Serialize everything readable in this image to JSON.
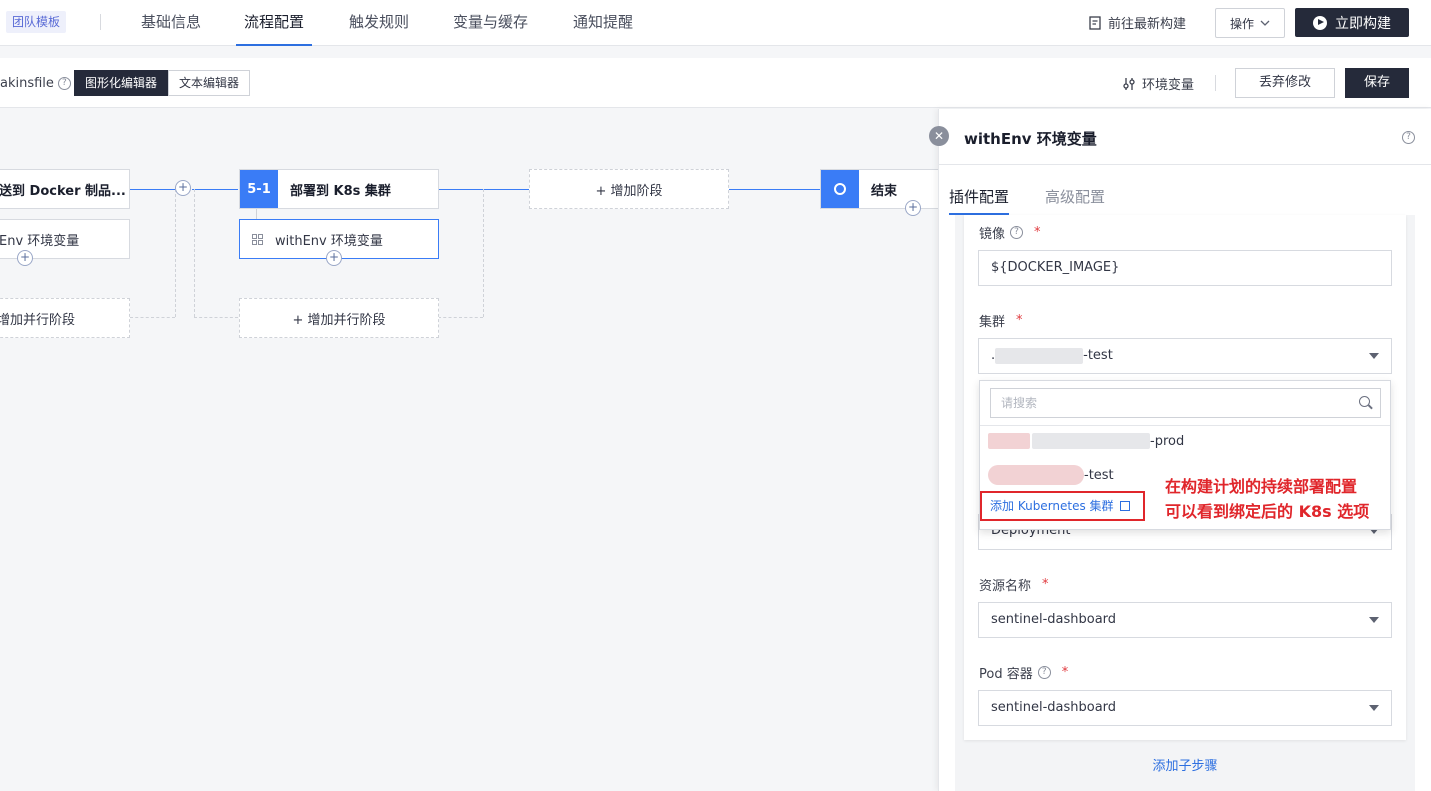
{
  "nav": {
    "team_tag": "团队模板",
    "tabs": [
      "基础信息",
      "流程配置",
      "触发规则",
      "变量与缓存",
      "通知提醒"
    ],
    "active_tab": "流程配置",
    "latest_build": "前往最新构建",
    "operations": "操作",
    "build_now": "立即构建"
  },
  "subbar": {
    "jenkinsfile_label": "akinsfile",
    "editor_graphic": "图形化编辑器",
    "editor_text": "文本编辑器",
    "env_vars": "环境变量",
    "discard": "丢弃修改",
    "save": "保存"
  },
  "canvas": {
    "stage_prev": "送到 Docker 制品...",
    "stage_prev_step": "Env 环境变量",
    "stage_prev_parallel": "增加并行阶段",
    "stage_index": "5-1",
    "stage_name": "部署到 K8s 集群",
    "stage_step": "withEnv 环境变量",
    "add_parallel": "+ 增加并行阶段",
    "add_stage": "+ 增加阶段",
    "end": "结束"
  },
  "panel": {
    "title": "withEnv 环境变量",
    "tabs": [
      "插件配置",
      "高级配置"
    ],
    "active_tab": "插件配置",
    "image_label": "镜像",
    "image_value": "${DOCKER_IMAGE}",
    "cluster_label": "集群",
    "cluster_value_suffix": "-test",
    "cluster_prefix_char": ".",
    "resource_type_value": "Deployment",
    "resource_name_label": "资源名称",
    "resource_name_value": "sentinel-dashboard",
    "pod_container_label": "Pod 容器",
    "pod_container_value": "sentinel-dashboard",
    "add_sub_step": "添加子步骤",
    "required_mark": "*"
  },
  "dropdown": {
    "search_placeholder": "请搜索",
    "options": [
      "-prod",
      "-test"
    ],
    "add_cluster": "添加 Kubernetes 集群"
  },
  "annotation": {
    "line1": "在构建计划的持续部署配置",
    "line2": "可以看到绑定后的 K8s 选项"
  },
  "colors": {
    "accent": "#3a7cf6",
    "dark_button": "#252a3a",
    "annotation_red": "#e0262b",
    "link_blue": "#2d6fe0"
  }
}
